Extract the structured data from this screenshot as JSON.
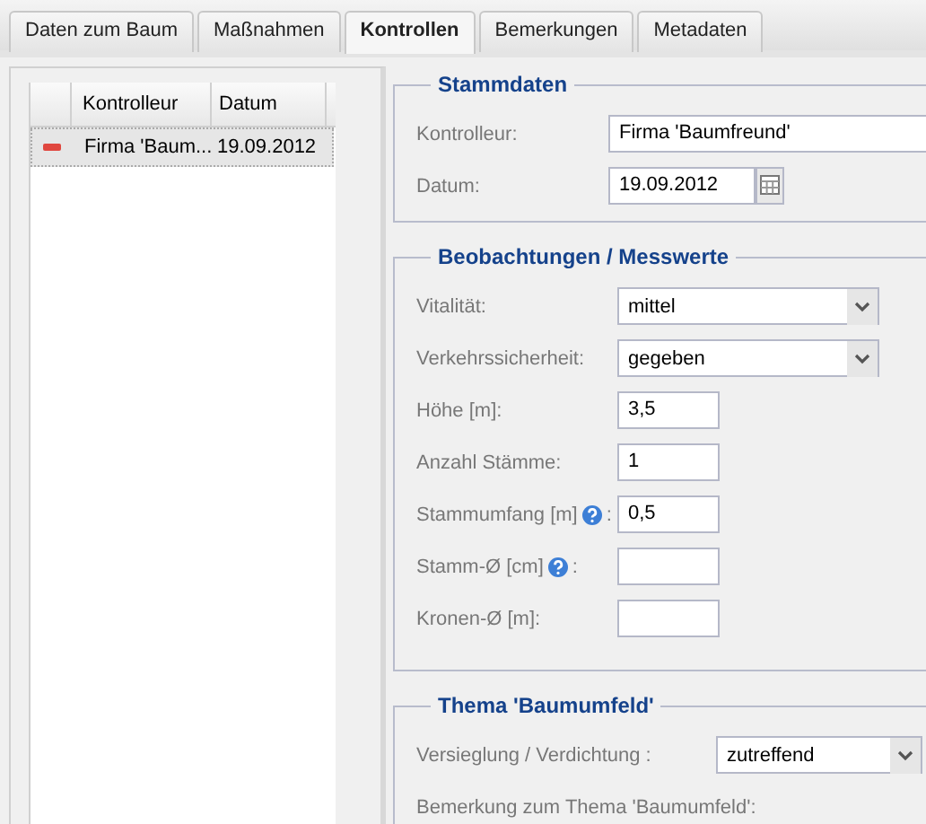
{
  "tabs": [
    {
      "label": "Daten zum Baum",
      "selected": false
    },
    {
      "label": "Maßnahmen",
      "selected": false
    },
    {
      "label": "Kontrollen",
      "selected": true
    },
    {
      "label": "Bemerkungen",
      "selected": false
    },
    {
      "label": "Metadaten",
      "selected": false
    }
  ],
  "grid": {
    "columns": [
      "Kontrolleur",
      "Datum"
    ],
    "rows": [
      {
        "color": "#e0473f",
        "cells": [
          "Firma 'Baum...",
          "19.09.2012"
        ],
        "selected": true
      }
    ]
  },
  "sections": [
    {
      "legend": "Stammdaten",
      "fields": [
        {
          "kind": "text",
          "label": "Kontrolleur:",
          "value": "Firma 'Baumfreund'"
        },
        {
          "kind": "date",
          "label": "Datum:",
          "value": "19.09.2012"
        }
      ]
    },
    {
      "legend": "Beobachtungen / Messwerte",
      "fields": [
        {
          "kind": "select",
          "label": "Vitalität:",
          "value": "mittel"
        },
        {
          "kind": "select",
          "label": "Verkehrssicherheit:",
          "value": "gegeben"
        },
        {
          "kind": "number",
          "label": "Höhe [m]:",
          "value": "3,5"
        },
        {
          "kind": "number",
          "label": "Anzahl Stämme:",
          "value": "1"
        },
        {
          "kind": "number",
          "label": "Stammumfang [m]",
          "help": true,
          "suffix": ":",
          "value": "0,5"
        },
        {
          "kind": "number",
          "label": "Stamm-Ø [cm]",
          "help": true,
          "suffix": ":"
        },
        {
          "kind": "number",
          "label": "Kronen-Ø [m]:"
        }
      ]
    },
    {
      "legend": "Thema 'Baumumfeld'",
      "fields": [
        {
          "kind": "select",
          "label": "Versieglung / Verdichtung :",
          "value": "zutreffend"
        },
        {
          "kind": "caption",
          "label": "Bemerkung zum Thema 'Baumumfeld':"
        }
      ]
    }
  ]
}
